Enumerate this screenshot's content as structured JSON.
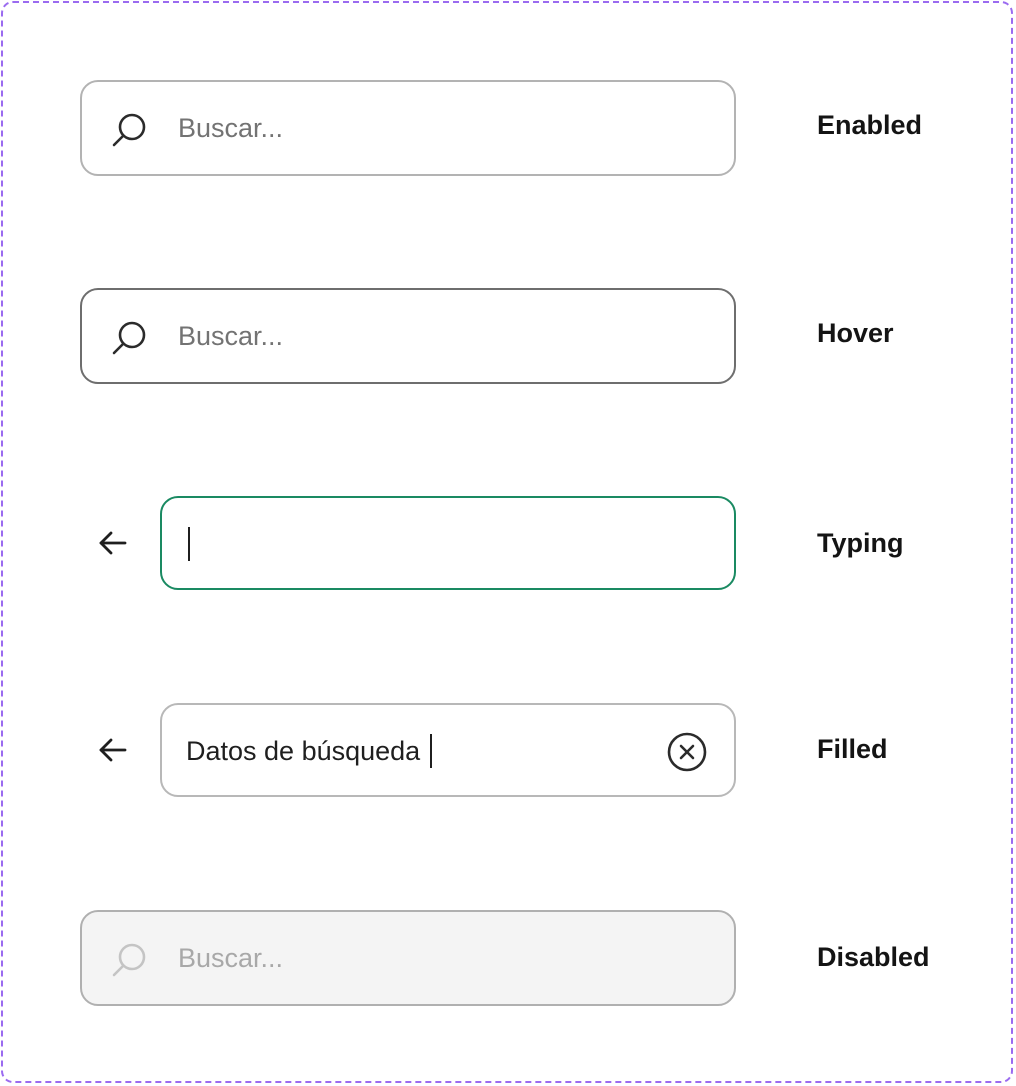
{
  "states": {
    "enabled": {
      "label": "Enabled",
      "placeholder": "Buscar..."
    },
    "hover": {
      "label": "Hover",
      "placeholder": "Buscar..."
    },
    "typing": {
      "label": "Typing",
      "value": ""
    },
    "filled": {
      "label": "Filled",
      "value": "Datos de búsqueda"
    },
    "disabled": {
      "label": "Disabled",
      "placeholder": "Buscar..."
    }
  },
  "icons": {
    "search": "search-icon",
    "back": "arrow-left-icon",
    "clear": "close-circle-icon"
  },
  "colors": {
    "frame_border": "#9b6bf0",
    "enabled_border": "#b3b3b3",
    "hover_border": "#6e6e6e",
    "typing_border": "#1a8a62",
    "disabled_fill": "#f4f4f4"
  }
}
